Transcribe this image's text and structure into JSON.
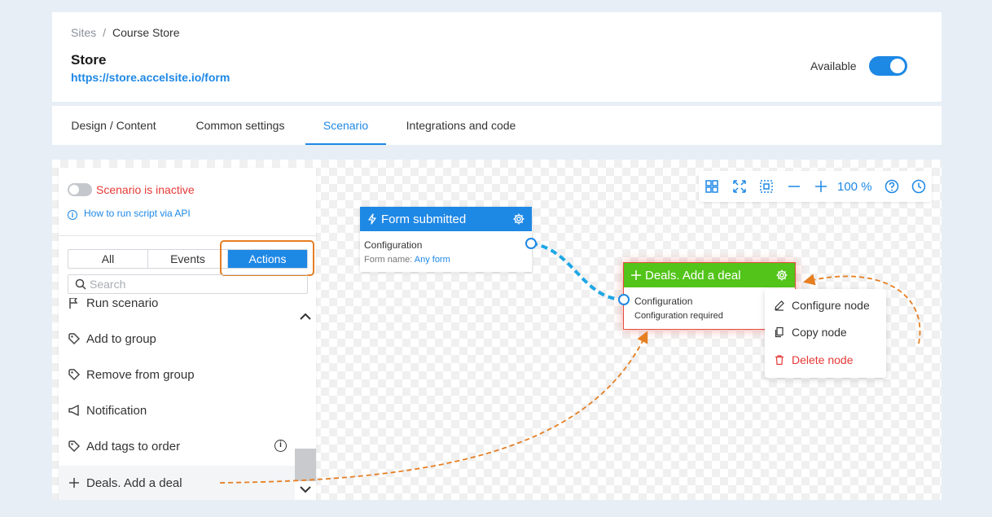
{
  "breadcrumb": {
    "root": "Sites",
    "separator": "/",
    "current": "Course Store"
  },
  "site": {
    "title": "Store",
    "url": "https://store.accelsite.io/form",
    "availability_label": "Available"
  },
  "tabs": [
    {
      "label": "Design / Content"
    },
    {
      "label": "Common settings"
    },
    {
      "label": "Scenario"
    },
    {
      "label": "Integrations and code"
    }
  ],
  "panel": {
    "status": "Scenario is inactive",
    "api_link": "How to run script via API",
    "filters": [
      {
        "label": "All"
      },
      {
        "label": "Events"
      },
      {
        "label": "Actions"
      }
    ],
    "search_placeholder": "Search",
    "items": [
      {
        "label": "Run scenario",
        "icon": "flag-icon"
      },
      {
        "label": "Add to group",
        "icon": "tag-icon"
      },
      {
        "label": "Remove from group",
        "icon": "tag-icon"
      },
      {
        "label": "Notification",
        "icon": "megaphone-icon"
      },
      {
        "label": "Add tags to order",
        "icon": "tag-icon"
      },
      {
        "label": "Deals. Add a deal",
        "icon": "plus-icon"
      }
    ]
  },
  "toolbar": {
    "zoom": "100 %"
  },
  "nodes": {
    "form": {
      "title": "Form submitted",
      "config_label": "Configuration",
      "detail_label": "Form name:",
      "detail_value": "Any form"
    },
    "deal": {
      "title": "Deals. Add a deal",
      "config_label": "Configuration",
      "detail": "Configuration required"
    }
  },
  "context_menu": {
    "configure": "Configure node",
    "copy": "Copy node",
    "delete": "Delete node"
  },
  "colors": {
    "accent": "#1e88e5",
    "success": "#52c41a",
    "danger": "#e53935",
    "annotation": "#e67e22"
  }
}
